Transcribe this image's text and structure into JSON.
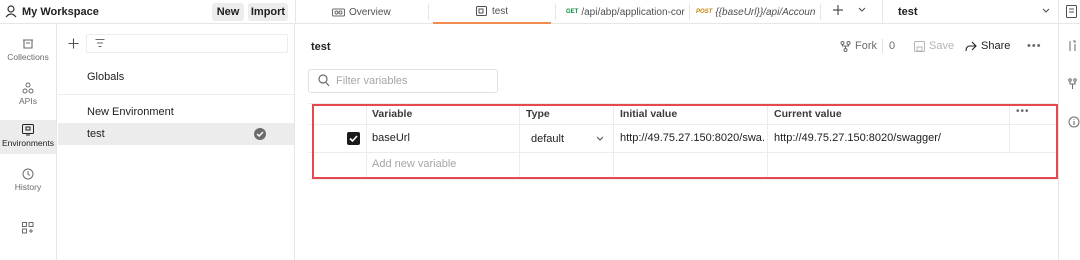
{
  "workspace": {
    "title": "My Workspace",
    "new_label": "New",
    "import_label": "Import"
  },
  "tabs": [
    {
      "label": "Overview"
    },
    {
      "label": "test"
    },
    {
      "method": "GET",
      "label": "/api/abp/application-cor"
    },
    {
      "method": "POST",
      "label": "{{baseUrl}}/api/Accoun"
    }
  ],
  "environment_selector": {
    "value": "test"
  },
  "rail": {
    "items": [
      {
        "label": "Collections",
        "icon": "collections-icon"
      },
      {
        "label": "APIs",
        "icon": "apis-icon"
      },
      {
        "label": "Environments",
        "icon": "environments-icon",
        "active": true
      },
      {
        "label": "History",
        "icon": "history-icon"
      },
      {
        "label": "",
        "icon": "configure-sidebar-icon"
      }
    ]
  },
  "env_list": {
    "globals": "Globals",
    "items": [
      {
        "label": "New Environment"
      },
      {
        "label": "test",
        "selected": true
      }
    ]
  },
  "main": {
    "title": "test",
    "fork_label": "Fork",
    "fork_count": "0",
    "save_label": "Save",
    "share_label": "Share",
    "filter_placeholder": "Filter variables"
  },
  "table": {
    "headers": {
      "variable": "Variable",
      "type": "Type",
      "initial": "Initial value",
      "current": "Current value"
    },
    "rows": [
      {
        "checked": true,
        "variable": "baseUrl",
        "type": "default",
        "initial": "http://49.75.27.150:8020/swa...",
        "current": "http://49.75.27.150:8020/swagger/"
      }
    ],
    "add_placeholder": "Add new variable"
  },
  "colors": {
    "accent_tab": "#f28c4f",
    "highlight_border": "#e5484d",
    "get_method": "#0c8a3f",
    "post_method": "#c4860a"
  }
}
